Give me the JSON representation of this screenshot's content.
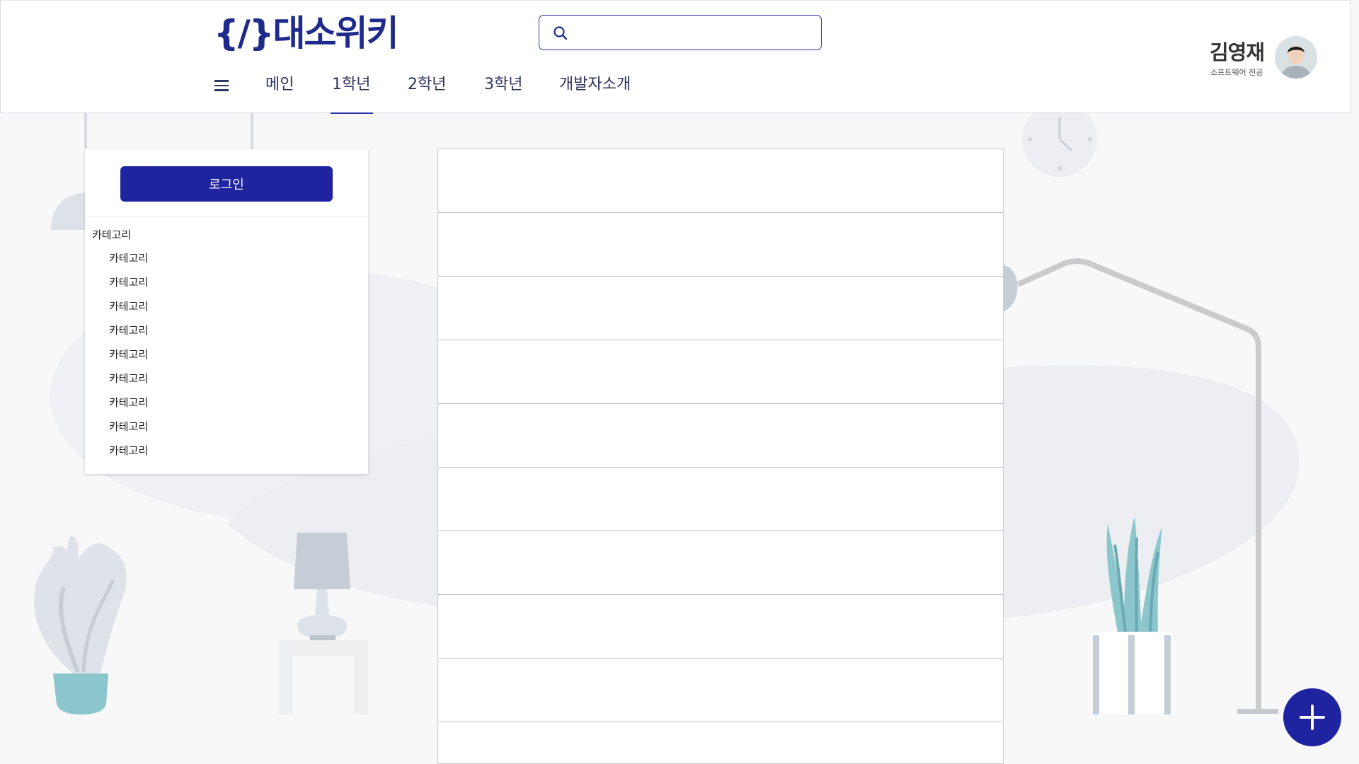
{
  "brand": {
    "logo_text": "{/}대소위키"
  },
  "search": {
    "placeholder": "",
    "value": ""
  },
  "nav": {
    "items": [
      {
        "label": "메인",
        "active": false
      },
      {
        "label": "1학년",
        "active": true
      },
      {
        "label": "2학년",
        "active": false
      },
      {
        "label": "3학년",
        "active": false
      },
      {
        "label": "개발자소개",
        "active": false
      }
    ]
  },
  "profile": {
    "name": "김영재",
    "subtitle": "소프트웨어 전공"
  },
  "sidebar": {
    "login_label": "로그인",
    "root_category": "카테고리",
    "categories": [
      "카테고리",
      "카테고리",
      "카테고리",
      "카테고리",
      "카테고리",
      "카테고리",
      "카테고리",
      "카테고리",
      "카테고리"
    ]
  },
  "main": {
    "row_count": 10
  },
  "colors": {
    "accent": "#1e23a0",
    "nav_text": "#2e355e",
    "background": "#f8f8f9"
  },
  "icons": {
    "search": "search-icon",
    "menu": "hamburger-menu-icon",
    "fab": "plus-icon"
  }
}
